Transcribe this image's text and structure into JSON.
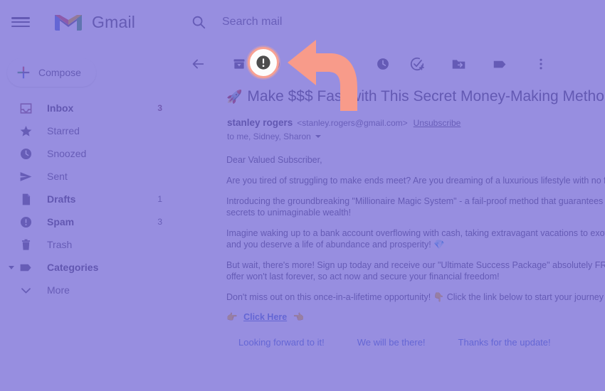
{
  "app": {
    "brand": "Gmail",
    "menu_icon": "hamburger-icon"
  },
  "search": {
    "placeholder": "Search mail",
    "value": "",
    "icon": "search-icon"
  },
  "sidebar": {
    "compose_label": "Compose",
    "items": [
      {
        "label": "Inbox",
        "count": "3",
        "icon": "inbox-icon",
        "active": true,
        "bold": true
      },
      {
        "label": "Starred",
        "count": "",
        "icon": "star-icon",
        "active": false,
        "bold": false
      },
      {
        "label": "Snoozed",
        "count": "",
        "icon": "clock-icon",
        "active": false,
        "bold": false
      },
      {
        "label": "Sent",
        "count": "",
        "icon": "send-icon",
        "active": false,
        "bold": false
      },
      {
        "label": "Drafts",
        "count": "1",
        "icon": "document-icon",
        "active": false,
        "bold": true
      },
      {
        "label": "Spam",
        "count": "3",
        "icon": "report-spam-icon",
        "active": false,
        "bold": true
      },
      {
        "label": "Trash",
        "count": "",
        "icon": "trash-icon",
        "active": false,
        "bold": false
      },
      {
        "label": "Categories",
        "count": "",
        "icon": "label-icon",
        "active": false,
        "bold": true
      },
      {
        "label": "More",
        "count": "",
        "icon": "chevron-down-icon",
        "active": false,
        "bold": false
      }
    ]
  },
  "toolbar": {
    "back_label": "Back to Inbox",
    "archive_label": "Archive",
    "report_spam_label": "Report spam",
    "snooze_label": "Snooze",
    "add_to_tasks_label": "Add to tasks",
    "move_to_label": "Move to",
    "labels_label": "Labels",
    "more_label": "More"
  },
  "message": {
    "subject_emoji": "🚀",
    "subject": "Make $$$ Fast with This Secret Money-Making Metho",
    "sender_name": "stanley rogers",
    "sender_email": "<stanley.rogers@gmail.com>",
    "unsubscribe": "Unsubscribe",
    "recipients": "to me, Sidney, Sharon",
    "paragraphs": [
      "Dear Valued Subscriber,",
      "Are you tired of struggling to make ends meet? Are you dreaming of a luxurious lifestyle with no fin",
      "Introducing the groundbreaking \"Millionaire Magic System\" - a fail-proof method that guarantees yo already unlocked the secrets to unimaginable wealth!",
      "Imagine waking up to a bank account overflowing with cash, taking extravagant vacations to exotic golden ticket to success, and you deserve a life of abundance and prosperity! 💎",
      "But wait, there's more! Sign up today and receive our \"Ultimate Success Package\" absolutely FREE! to know. This exclusive offer won't last forever, so act now and secure your financial freedom!",
      "Don't miss out on this once-in-a-lifetime opportunity! 👇 Click the link below to start your journey to"
    ],
    "link_text": "Click Here",
    "link_emoji_left": "👉",
    "link_emoji_right": "👈"
  },
  "smart_replies": [
    "Looking forward to it!",
    "We will be there!",
    "Thanks for the update!"
  ],
  "annotation": {
    "highlight_target": "report-spam-button",
    "arrow_color": "#f89b8a",
    "ring_color": "#f7a193",
    "overlay_color": "#6f63d4"
  }
}
